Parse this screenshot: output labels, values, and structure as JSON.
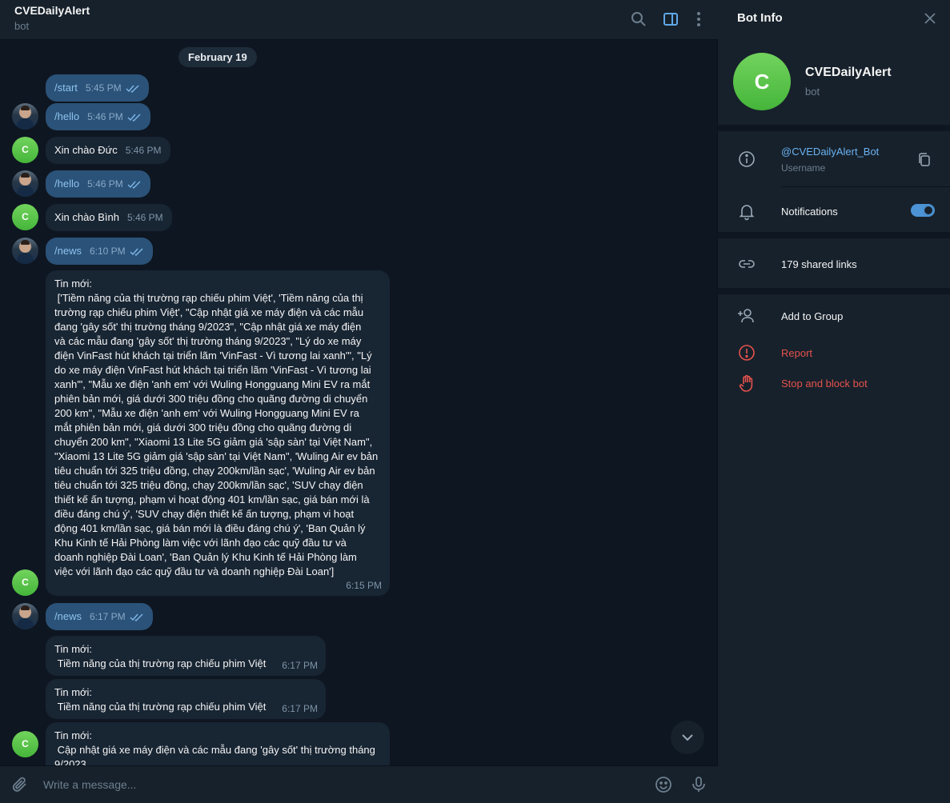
{
  "chat": {
    "title": "CVEDailyAlert",
    "subtitle": "bot",
    "date": "February 19",
    "composer_placeholder": "Write a message...",
    "avatar_letter": "C",
    "messages": [
      {
        "dir": "out",
        "text": "/start",
        "time": "5:45 PM"
      },
      {
        "dir": "out",
        "text": "/hello",
        "time": "5:46 PM"
      },
      {
        "dir": "in",
        "text": "Xin chào Đức",
        "time": "5:46 PM"
      },
      {
        "dir": "out",
        "text": "/hello",
        "time": "5:46 PM"
      },
      {
        "dir": "in",
        "text": "Xin chào Bình",
        "time": "5:46 PM"
      },
      {
        "dir": "out",
        "text": "/news",
        "time": "6:10 PM"
      },
      {
        "dir": "in",
        "text": "Tin mới:\n ['Tiềm năng của thị trường rạp chiếu phim Việt', 'Tiềm năng của thị\ntrường rạp chiếu phim Việt', \"Cập nhật giá xe máy điện và các mẫu\nđang 'gây sốt' thị trường tháng 9/2023\", \"Cập nhật giá xe máy điện\nvà các mẫu đang 'gây sốt' thị trường tháng 9/2023\", \"Lý do xe máy\nđiện VinFast hút khách tại triển lãm 'VinFast - Vì tương lai xanh'\", \"Lý\ndo xe máy điện VinFast hút khách tại triển lãm 'VinFast - Vì tương lai\nxanh'\", \"Mẫu xe điện 'anh em' với Wuling Hongguang Mini EV ra mắt\nphiên bản mới, giá dưới 300 triệu đồng cho quãng đường di chuyển\n200 km\", \"Mẫu xe điện 'anh em' với Wuling Hongguang Mini EV ra\nmắt phiên bản mới, giá dưới 300 triệu đồng cho quãng đường di\nchuyển 200 km\", \"Xiaomi 13 Lite 5G giảm giá 'sập sàn' tại Việt Nam\",\n\"Xiaomi 13 Lite 5G giảm giá 'sập sàn' tại Việt Nam\", 'Wuling Air ev bản\ntiêu chuẩn tới 325 triệu đồng, chạy 200km/lần sạc', 'Wuling Air ev bản\ntiêu chuẩn tới 325 triệu đồng, chạy 200km/lần sạc', 'SUV chạy điện\nthiết kế ấn tượng, phạm vi hoạt động 401 km/lần sạc, giá bán mới là\nđiều đáng chú ý', 'SUV chạy điện thiết kế ấn tượng, phạm vi hoạt\nđộng 401 km/lần sạc, giá bán mới là điều đáng chú ý', 'Ban Quản lý\nKhu Kinh tế Hải Phòng làm việc với lãnh đạo các quỹ đầu tư và\ndoanh nghiệp Đài Loan', 'Ban Quản lý Khu Kinh tế Hải Phòng làm\nviệc với lãnh đạo các quỹ đầu tư và doanh nghiệp Đài Loan']",
        "time": "6:15 PM"
      },
      {
        "dir": "out",
        "text": "/news",
        "time": "6:17 PM"
      },
      {
        "dir": "in",
        "text": "Tin mới:\n Tiềm năng của thị trường rạp chiếu phim Việt",
        "time": "6:17 PM"
      },
      {
        "dir": "in",
        "text": "Tin mới:\n Tiềm năng của thị trường rạp chiếu phim Việt",
        "time": "6:17 PM"
      },
      {
        "dir": "in",
        "text": "Tin mới:\n Cập nhật giá xe máy điện và các mẫu đang 'gây sốt' thị trường tháng\n9/2023",
        "time": ""
      }
    ]
  },
  "panel": {
    "title": "Bot Info",
    "avatar_letter": "C",
    "name": "CVEDailyAlert",
    "subtitle": "bot",
    "username": "@CVEDailyAlert_Bot",
    "username_label": "Username",
    "notifications_label": "Notifications",
    "notifications_on": true,
    "shared_links": "179 shared links",
    "add_to_group": "Add to Group",
    "report": "Report",
    "stop_block": "Stop and block bot"
  },
  "colors": {
    "background": "#0e1621",
    "panel": "#17212b",
    "outgoing_bubble": "#2b5278",
    "incoming_bubble": "#182533",
    "accent": "#6ab2f2",
    "danger": "#e5524d"
  },
  "icons": {
    "header": [
      "search-icon",
      "sidebar-toggle-icon",
      "more-vertical-icon"
    ],
    "composer": [
      "attach-icon",
      "emoji-icon",
      "microphone-icon"
    ],
    "panel": [
      "close-icon",
      "info-icon",
      "copy-icon",
      "bell-icon",
      "link-icon",
      "add-user-icon",
      "report-icon",
      "hand-stop-icon"
    ]
  }
}
